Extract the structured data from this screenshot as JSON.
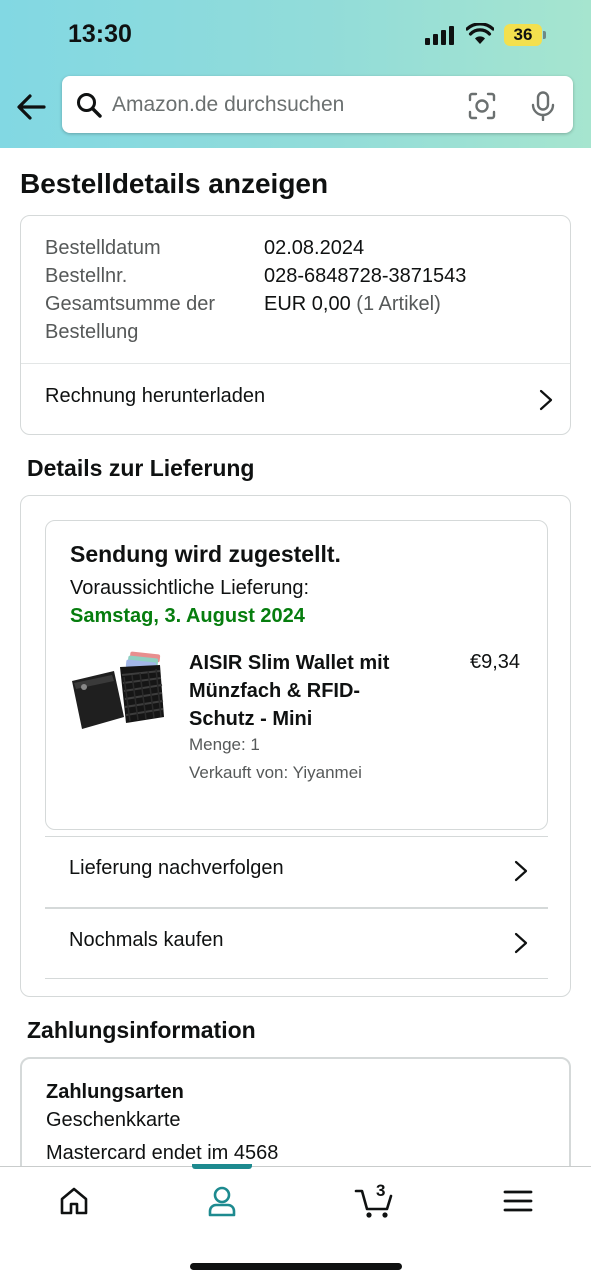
{
  "status_bar": {
    "time": "13:30",
    "battery": "36"
  },
  "search": {
    "placeholder": "Amazon.de durchsuchen"
  },
  "page": {
    "title": "Bestelldetails anzeigen"
  },
  "order_summary": {
    "order_date_label": "Bestelldatum",
    "order_date": "02.08.2024",
    "order_number_label": "Bestellnr.",
    "order_number": "028-6848728-3871543",
    "total_label_line1": "Gesamtsumme der",
    "total_label_line2": "Bestellung",
    "total_value": "EUR 0,00",
    "total_items": "(1 Artikel)",
    "invoice_link": "Rechnung herunterladen"
  },
  "delivery": {
    "section_title": "Details zur Lieferung",
    "status": "Sendung wird zugestellt.",
    "eta_label": "Voraussichtliche Lieferung:",
    "eta_date": "Samstag, 3. August 2024",
    "product": {
      "title_line1": "AISIR Slim Wallet mit",
      "title_line2": "Münzfach & RFID-",
      "title_line3": "Schutz - Mini",
      "price": "€9,34",
      "quantity": "Menge: 1",
      "seller": "Verkauft von: Yiyanmei"
    },
    "track_link": "Lieferung nachverfolgen",
    "buy_again_link": "Nochmals kaufen"
  },
  "payment": {
    "section_title": "Zahlungsinformation",
    "methods_label": "Zahlungsarten",
    "method1": "Geschenkkarte",
    "method2": "Mastercard endet im 4568"
  },
  "tabbar": {
    "cart_count": "3",
    "active_tab": "account"
  },
  "colors": {
    "accent": "#1d8a8f",
    "eta_green": "#067d0e",
    "header_start": "#82d8e3",
    "header_end": "#a6e5cf"
  }
}
